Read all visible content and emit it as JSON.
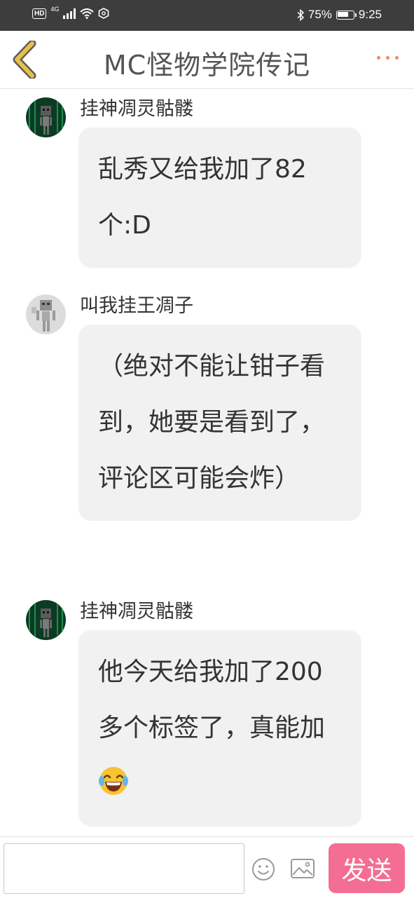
{
  "status_bar": {
    "hd": "HD",
    "network": "4G",
    "battery_percent": "75%",
    "battery_level": 0.75,
    "time": "9:25",
    "icons": [
      "hd-badge",
      "signal-icon",
      "wifi-icon",
      "nfc-icon",
      "bluetooth-icon",
      "battery-icon"
    ]
  },
  "header": {
    "title": "MC怪物学院传记",
    "back_icon": "chevron-left-icon",
    "more_icon": "more-dots-icon"
  },
  "colors": {
    "accent_back": "#e5c14a",
    "accent_more": "#f08a5d",
    "send_button": "#f46d92",
    "bubble": "#f1f1f1"
  },
  "messages": [
    {
      "sender": "挂神凋灵骷髅",
      "avatar": "avatar-wither-skeleton-green",
      "text": "乱秀又给我加了82个:D"
    },
    {
      "sender": "叫我挂王凋子",
      "avatar": "avatar-skeleton-gray",
      "text": "（绝对不能让钳子看到，她要是看到了，评论区可能会炸）"
    },
    {
      "sender": "挂神凋灵骷髅",
      "avatar": "avatar-wither-skeleton-green",
      "text": "他今天给我加了200多个标签了，真能加",
      "emoji": "joy-emoji"
    }
  ],
  "input_bar": {
    "placeholder": "",
    "value": "",
    "emoji_icon": "smiley-icon",
    "image_icon": "image-icon",
    "send_label": "发送"
  }
}
